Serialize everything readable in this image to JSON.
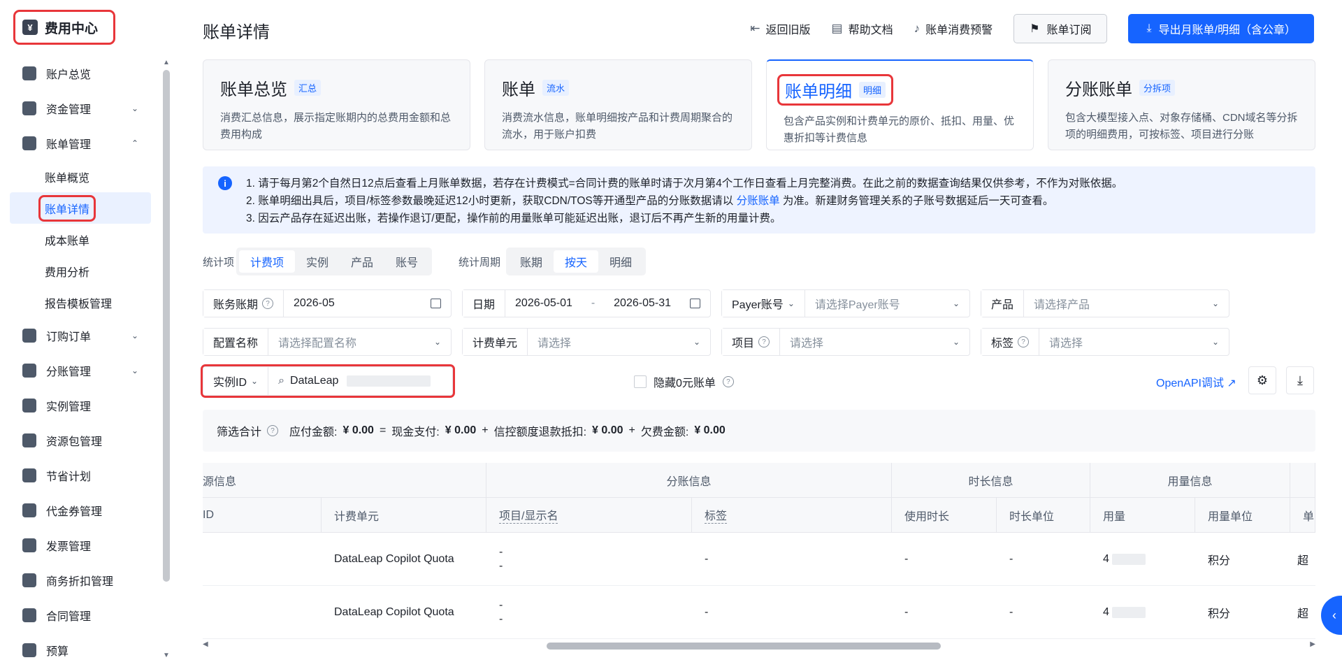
{
  "sidebar": {
    "brand": "费用中心",
    "items": [
      {
        "label": "账户总览",
        "icon": "home-icon"
      },
      {
        "label": "资金管理",
        "icon": "wallet-icon",
        "chevron": "⌄"
      },
      {
        "label": "账单管理",
        "icon": "bill-icon",
        "chevron": "⌃"
      },
      {
        "label": "订购订单",
        "icon": "order-icon",
        "chevron": "⌄"
      },
      {
        "label": "分账管理",
        "icon": "split-icon",
        "chevron": "⌄"
      },
      {
        "label": "实例管理",
        "icon": "cube-icon"
      },
      {
        "label": "资源包管理",
        "icon": "package-icon"
      },
      {
        "label": "节省计划",
        "icon": "database-icon"
      },
      {
        "label": "代金券管理",
        "icon": "coupon-icon"
      },
      {
        "label": "发票管理",
        "icon": "invoice-icon"
      },
      {
        "label": "商务折扣管理",
        "icon": "tag-icon"
      },
      {
        "label": "合同管理",
        "icon": "contract-icon"
      },
      {
        "label": "预算",
        "icon": "budget-icon"
      }
    ],
    "bill_sub": [
      "账单概览",
      "账单详情",
      "成本账单",
      "费用分析",
      "报告模板管理"
    ]
  },
  "header": {
    "title": "账单详情",
    "links": [
      "返回旧版",
      "帮助文档",
      "账单消费预警"
    ],
    "subscribe": "账单订阅",
    "export": "导出月账单/明细（含公章）"
  },
  "cards": [
    {
      "title": "账单总览",
      "tag": "汇总",
      "desc": "消费汇总信息，展示指定账期内的总费用金额和总费用构成"
    },
    {
      "title": "账单",
      "tag": "流水",
      "desc": "消费流水信息，账单明细按产品和计费周期聚合的流水，用于账户扣费"
    },
    {
      "title": "账单明细",
      "tag": "明细",
      "desc": "包含产品实例和计费单元的原价、抵扣、用量、优惠折扣等计费信息"
    },
    {
      "title": "分账账单",
      "tag": "分拆项",
      "desc": "包含大模型接入点、对象存储桶、CDN域名等分拆项的明细费用，可按标签、项目进行分账"
    }
  ],
  "notice": {
    "line1": "1. 请于每月第2个自然日12点后查看上月账单数据，若存在计费模式=合同计费的账单时请于次月第4个工作日查看上月完整消费。在此之前的数据查询结果仅供参考，不作为对账依据。",
    "line2a": "2. 账单明细出具后，项目/标签参数最晚延迟12小时更新，获取CDN/TOS等开通型产品的分账数据请以",
    "line2link": "分账账单",
    "line2b": "为准。新建财务管理关系的子账号数据延后一天可查看。",
    "line3": "3. 因云产品存在延迟出账，若操作退订/更配，操作前的用量账单可能延迟出账，退订后不再产生新的用量计费。"
  },
  "stats": {
    "label": "统计项",
    "options": [
      "计费项",
      "实例",
      "产品",
      "账号"
    ],
    "period_label": "统计周期",
    "period_options": [
      "账期",
      "按天",
      "明细"
    ]
  },
  "filters": {
    "period_label": "账务账期",
    "period_value": "2026-05",
    "date_label": "日期",
    "date_start": "2026-05-01",
    "date_sep": "-",
    "date_end": "2026-05-31",
    "payer_label": "Payer账号",
    "payer_ph": "请选择Payer账号",
    "product_label": "产品",
    "product_ph": "请选择产品",
    "config_label": "配置名称",
    "config_ph": "请选择配置名称",
    "unit_label": "计费单元",
    "unit_ph": "请选择",
    "project_label": "项目",
    "project_ph": "请选择",
    "tag_label": "标签",
    "tag_ph": "请选择",
    "instance_label": "实例ID",
    "instance_value": "DataLeap",
    "hide_zero": "隐藏0元账单",
    "openapi": "OpenAPI调试"
  },
  "summary": {
    "label": "筛选合计",
    "payable": "应付金额:",
    "payable_val": "¥ 0.00",
    "eq": "=",
    "cash": "现金支付:",
    "cash_val": "¥ 0.00",
    "plus1": "+",
    "credit": "信控额度退款抵扣:",
    "credit_val": "¥ 0.00",
    "plus2": "+",
    "owed": "欠费金额:",
    "owed_val": "¥ 0.00"
  },
  "table": {
    "groups": [
      "源信息",
      "分账信息",
      "时长信息",
      "用量信息"
    ],
    "columns": [
      "ID",
      "计费单元",
      "项目/显示名",
      "标签",
      "使用时长",
      "时长单位",
      "用量",
      "用量单位",
      "单"
    ],
    "rows": [
      {
        "unit": "DataLeap Copilot Quota",
        "project": "-",
        "project2": "-",
        "tag": "-",
        "duration": "-",
        "duration_unit": "-",
        "usage": "4",
        "usage_unit": "积分",
        "extra": "超"
      },
      {
        "unit": "DataLeap Copilot Quota",
        "project": "-",
        "project2": "-",
        "tag": "-",
        "duration": "-",
        "duration_unit": "-",
        "usage": "4",
        "usage_unit": "积分",
        "extra": "超"
      }
    ]
  },
  "colors": {
    "primary": "#1664ff",
    "highlight": "#e8363a"
  }
}
